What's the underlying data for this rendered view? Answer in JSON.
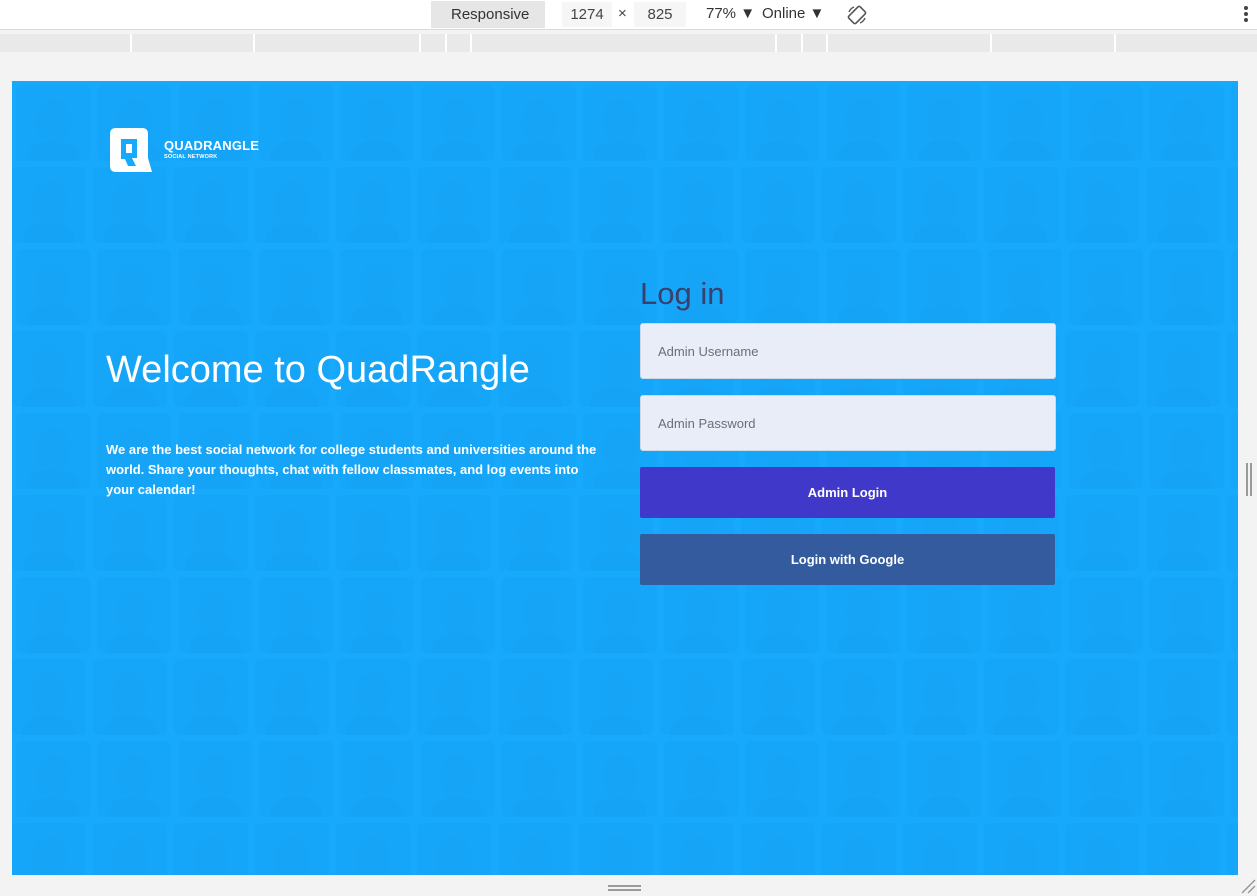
{
  "devtools": {
    "device": "Responsive",
    "width": "1274",
    "times": "×",
    "height": "825",
    "zoom": "77% ▼",
    "network": "Online ▼",
    "device_caret": "▼"
  },
  "brand": {
    "title": "QUADRANGLE",
    "subtitle": "SOCIAL NETWORK",
    "logo_letter": "Q"
  },
  "hero": {
    "heading": "Welcome to QuadRangle",
    "description": "We are the best social network for college students and universities around the world. Share your thoughts, chat with fellow classmates, and log events into your calendar!"
  },
  "login": {
    "title": "Log in",
    "username_placeholder": "Admin Username",
    "password_placeholder": "Admin Password",
    "admin_button": "Admin Login",
    "google_button": "Login with Google"
  },
  "colors": {
    "background": "#17aafc",
    "admin_button": "#3f38c8",
    "google_button": "#335b9d",
    "login_title": "#3a3f6b"
  }
}
